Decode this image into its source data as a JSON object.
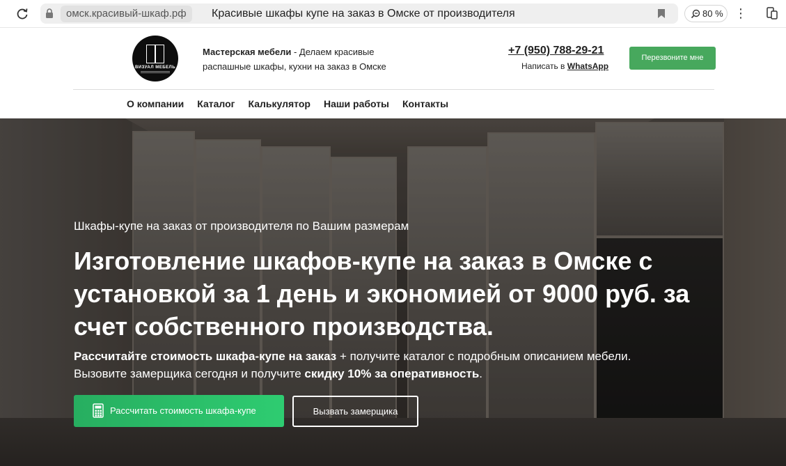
{
  "browser": {
    "domain": "омск.красивый-шкаф.рф",
    "page_title": "Красивые шкафы купе на заказ в Омске от производителя",
    "zoom": "80 %"
  },
  "header": {
    "logo_text": "ВИЗУАЛ МЕБЕЛЬ",
    "company_name": "Мастерская мебели",
    "tagline": " - Делаем красивые распашные шкафы, кухни на заказ в Омске",
    "phone": "+7 (950) 788-29-21",
    "write_prefix": "Написать в ",
    "whatsapp": "WhatsApp",
    "callback_button": "Перезвоните мне"
  },
  "nav": {
    "items": [
      "О компании",
      "Каталог",
      "Калькулятор",
      "Наши работы",
      "Контакты"
    ]
  },
  "hero": {
    "subtitle": "Шкафы-купе на заказ от производителя по Вашим размерам",
    "title": "Изготовление шкафов-купе на заказ в Омске с установкой за 1 день и экономией от 9000 руб. за счет собственного производства.",
    "line1_bold": "Рассчитайте стоимость шкафа-купе на заказ",
    "line1_rest": " + получите каталог с подробным описанием мебели.",
    "line2_start": "Вызовите замерщика сегодня и получите ",
    "line2_bold": "скидку 10% за оперативность",
    "line2_end": ".",
    "btn_calc": "Рассчитать стоимость шкафа-купе",
    "btn_measure": "Вызвать замерщика"
  }
}
